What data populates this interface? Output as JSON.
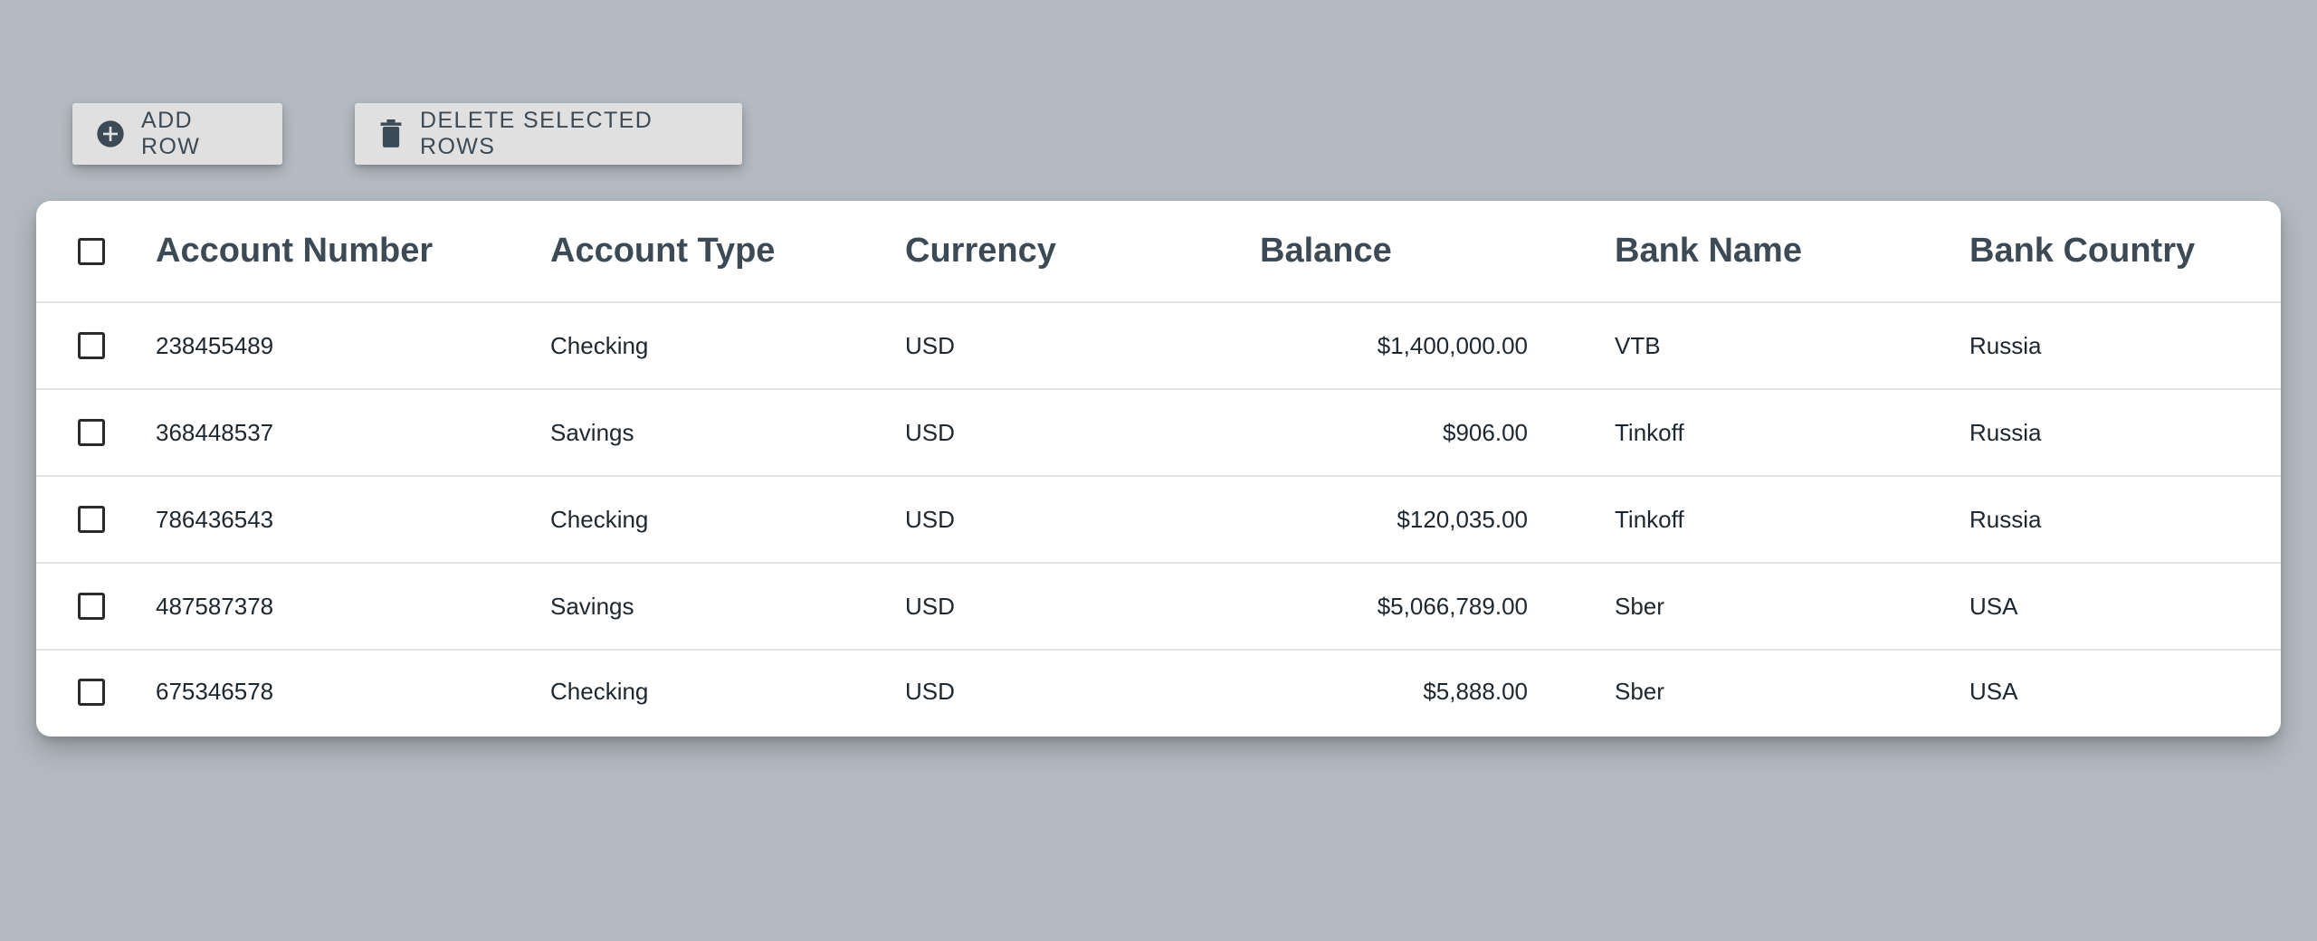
{
  "toolbar": {
    "add_row_label": "ADD ROW",
    "add_row_icon": "plus-circle-icon",
    "delete_rows_label": "DELETE SELECTED ROWS",
    "delete_rows_icon": "trash-icon"
  },
  "table": {
    "columns": [
      "Account Number",
      "Account Type",
      "Currency",
      "Balance",
      "Bank Name",
      "Bank Country"
    ],
    "rows": [
      {
        "account_number": "238455489",
        "account_type": "Checking",
        "currency": "USD",
        "balance": "$1,400,000.00",
        "bank_name": "VTB",
        "bank_country": "Russia"
      },
      {
        "account_number": "368448537",
        "account_type": "Savings",
        "currency": "USD",
        "balance": "$906.00",
        "bank_name": "Tinkoff",
        "bank_country": "Russia"
      },
      {
        "account_number": "786436543",
        "account_type": "Checking",
        "currency": "USD",
        "balance": "$120,035.00",
        "bank_name": "Tinkoff",
        "bank_country": "Russia"
      },
      {
        "account_number": "487587378",
        "account_type": "Savings",
        "currency": "USD",
        "balance": "$5,066,789.00",
        "bank_name": "Sber",
        "bank_country": "USA"
      },
      {
        "account_number": "675346578",
        "account_type": "Checking",
        "currency": "USD",
        "balance": "$5,888.00",
        "bank_name": "Sber",
        "bank_country": "USA"
      }
    ]
  },
  "colors": {
    "background": "#b3bac1",
    "button_bg": "#e0e0e0",
    "accent_text": "#3c4a56"
  }
}
